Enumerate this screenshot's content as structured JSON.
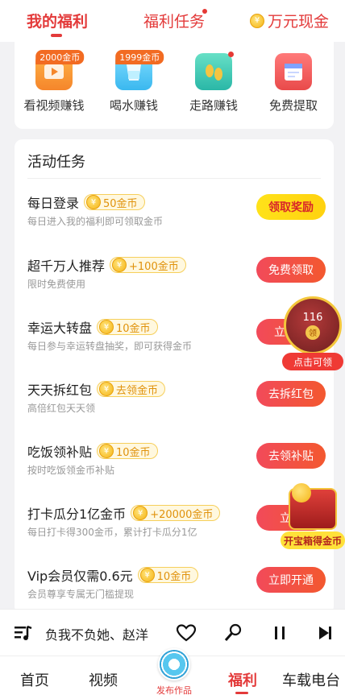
{
  "top_tabs": {
    "my_welfare": "我的福利",
    "welfare_tasks": "福利任务",
    "cash": "万元现金"
  },
  "quick_actions": [
    {
      "label": "看视频赚钱",
      "badge": "2000金币",
      "icon": "video-icon",
      "color": "#f59a2b"
    },
    {
      "label": "喝水赚钱",
      "badge": "1999金币",
      "icon": "water-cup-icon",
      "color": "#3ec3f0"
    },
    {
      "label": "走路赚钱",
      "badge": "",
      "icon": "footprints-icon",
      "color": "#45c9b8"
    },
    {
      "label": "免费提取",
      "badge": "",
      "icon": "calendar-icon",
      "color": "#e94a4a"
    }
  ],
  "activity": {
    "title": "活动任务",
    "tasks": [
      {
        "name": "每日登录",
        "reward": "50金币",
        "desc": "每日进入我的福利即可领取金币",
        "button": "领取奖励",
        "style": "yellow"
      },
      {
        "name": "超千万人推荐",
        "reward": "+100金币",
        "desc": "限时免费使用",
        "button": "免费领取",
        "style": "red"
      },
      {
        "name": "幸运大转盘",
        "reward": "10金币",
        "desc": "每日参与幸运转盘抽奖，即可获得金币",
        "button": "立即开",
        "style": "red"
      },
      {
        "name": "天天拆红包",
        "reward": "去领金币",
        "desc": "高倍红包天天领",
        "button": "去拆红包",
        "style": "red"
      },
      {
        "name": "吃饭领补贴",
        "reward": "10金币",
        "desc": "按时吃饭领金币补贴",
        "button": "去领补贴",
        "style": "red"
      },
      {
        "name": "打卡瓜分1亿金币",
        "reward": "+20000金币",
        "desc": "每日打卡得300金币，累计打卡瓜分1亿",
        "button": "立即",
        "style": "red"
      },
      {
        "name": "Vip会员仅需0.6元",
        "reward": "10金币",
        "desc": "会员尊享专属无门槛提现",
        "button": "立即开通",
        "style": "red"
      }
    ]
  },
  "floating_redpacket": {
    "count": "116",
    "coin_label": "领",
    "label": "点击可领"
  },
  "floating_treasure": {
    "label": "开宝箱得金币"
  },
  "player": {
    "song": "负我不负她、赵洋"
  },
  "bottom_nav": {
    "home": "首页",
    "video": "视频",
    "publish": "发布作品",
    "welfare": "福利",
    "car_radio": "车载电台"
  },
  "colors": {
    "accent": "#e33a3a",
    "coin": "#f5b414",
    "button_yellow": "#ffe21a"
  }
}
